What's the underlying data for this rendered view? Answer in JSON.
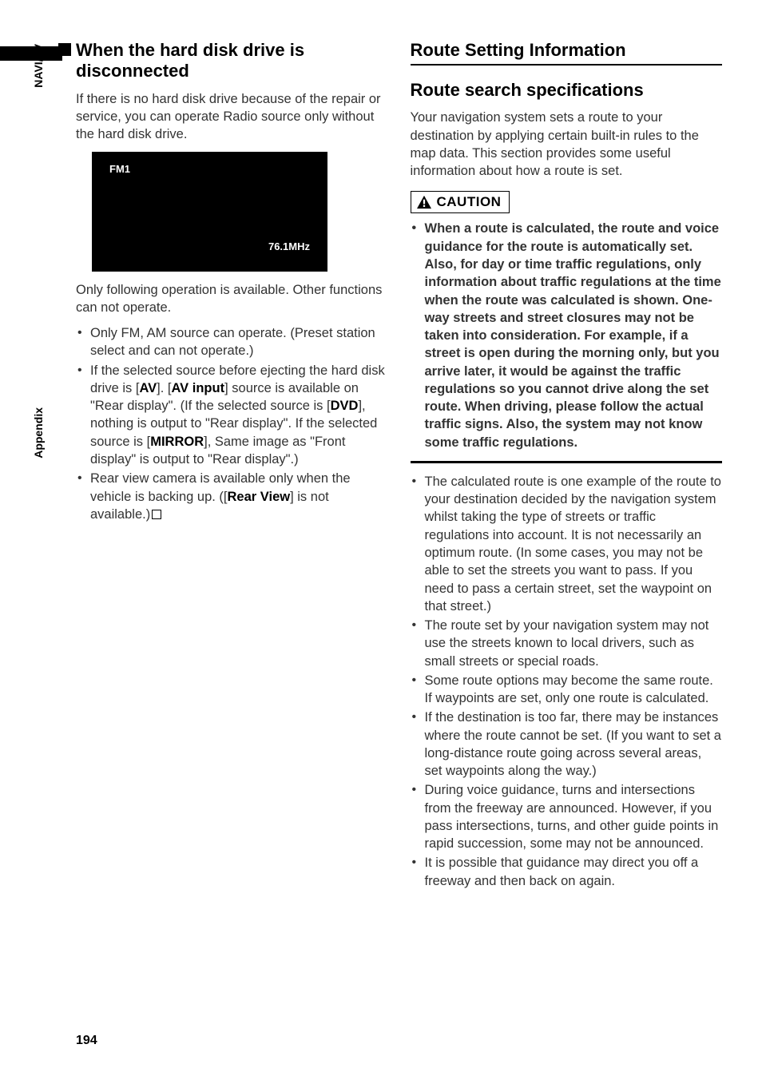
{
  "side": {
    "naviav": "NAVI/AV",
    "appendix": "Appendix"
  },
  "left": {
    "heading": "When the hard disk drive is disconnected",
    "intro": "If there is no hard disk drive because of the repair or service, you can operate Radio source only without the hard disk drive.",
    "radio": {
      "band": "FM1",
      "freq": "76.1MHz"
    },
    "after_img": "Only following operation is available. Other functions can not operate.",
    "bullets": {
      "b1": "Only FM, AM source can operate. (Preset station select and can not operate.)",
      "b2a": "If the selected source before ejecting the hard disk drive is [",
      "b2b": "AV",
      "b2c": "]. [",
      "b2d": "AV input",
      "b2e": "] source is available on \"Rear display\". (If the selected source is [",
      "b2f": "DVD",
      "b2g": "], nothing is output to \"Rear display\". If the selected source is [",
      "b2h": "MIRROR",
      "b2i": "], Same image as \"Front display\" is output to \"Rear display\".)",
      "b3a": "Rear view camera is available only when the vehicle is backing up. ([",
      "b3b": "Rear View",
      "b3c": "] is not available.)"
    }
  },
  "right": {
    "title": "Route Setting Information",
    "sub": "Route search specifications",
    "intro": "Your navigation system sets a route to your destination by applying certain built-in rules to the map data. This section provides some useful information about how a route is set.",
    "caution_label": "CAUTION",
    "caution_text": "When a route is calculated, the route and voice guidance for the route is automatically set. Also, for day or time traffic regulations, only information about traffic regulations at the time when the route was calculated is shown. One-way streets and street closures may not be taken into consideration. For example, if a street is open during the morning only, but you arrive later, it would be against the traffic regulations so you cannot drive along the set route. When driving, please follow the actual traffic signs. Also, the system may not know some traffic regulations.",
    "bullets": {
      "r1": "The calculated route is one example of the route to your destination decided by the navigation system whilst taking the type of streets or traffic regulations into account. It is not necessarily an optimum route. (In some cases, you may not be able to set the streets you want to pass. If you need to pass a certain street, set the waypoint on that street.)",
      "r2": "The route set by your navigation system may not use the streets known to local drivers, such as small streets or special roads.",
      "r3": "Some route options may become the same route. If waypoints are set, only one route is calculated.",
      "r4": "If the destination is too far, there may be instances where the route cannot be set. (If you want to set a long-distance route going across several areas, set waypoints along the way.)",
      "r5": "During voice guidance, turns and intersections from the freeway are announced. However, if you pass intersections, turns, and other guide points in rapid succession, some may not be announced.",
      "r6": "It is possible that guidance may direct you off a freeway and then back on again."
    }
  },
  "page_num": "194"
}
